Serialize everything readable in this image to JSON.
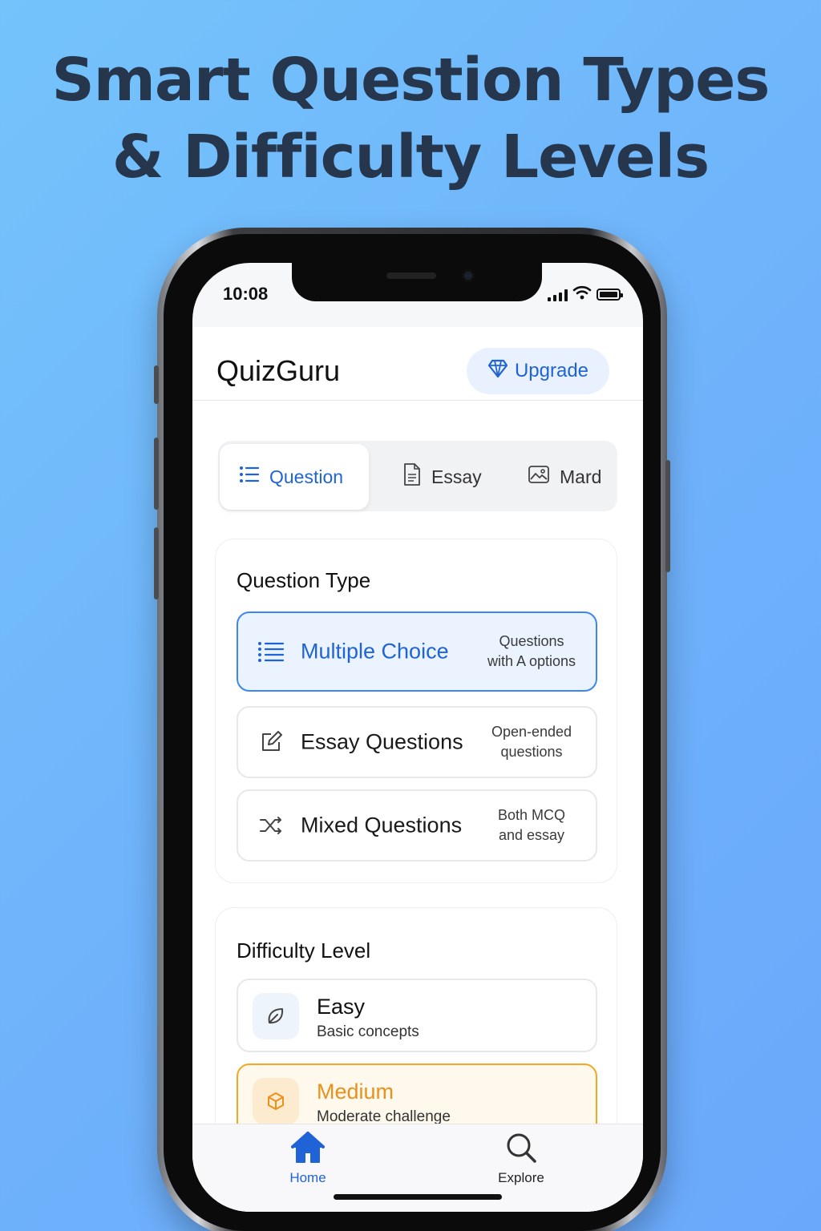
{
  "headline": {
    "line1": "Smart Question Types",
    "line2": "& Difficulty Levels"
  },
  "status_bar": {
    "time": "10:08",
    "icons": [
      "signal-icon",
      "wifi-icon",
      "battery-icon"
    ]
  },
  "header": {
    "title": "QuizGuru",
    "upgrade_label": "Upgrade",
    "upgrade_icon": "diamond-icon"
  },
  "tabs": [
    {
      "label": "Question",
      "icon": "list-icon",
      "active": true
    },
    {
      "label": "Essay",
      "icon": "document-icon",
      "active": false
    },
    {
      "label": "Mard",
      "icon": "image-icon",
      "active": false
    }
  ],
  "question_type": {
    "title": "Question Type",
    "options": [
      {
        "label": "Multiple Choice",
        "desc_line1": "Questions",
        "desc_line2": "with A options",
        "icon": "list-icon",
        "selected": true
      },
      {
        "label": "Essay Questions",
        "desc_line1": "Open-ended",
        "desc_line2": "questions",
        "icon": "edit-icon",
        "selected": false
      },
      {
        "label": "Mixed Questions",
        "desc_line1": "Both MCQ",
        "desc_line2": "and essay",
        "icon": "shuffle-icon",
        "selected": false
      }
    ]
  },
  "difficulty": {
    "title": "Difficulty Level",
    "levels": [
      {
        "name": "Easy",
        "desc": "Basic concepts",
        "icon": "leaf-icon",
        "selected": false
      },
      {
        "name": "Medium",
        "desc": "Moderate challenge",
        "icon": "cube-icon",
        "selected": true
      }
    ]
  },
  "bottom_nav": {
    "items": [
      {
        "label": "Home",
        "icon": "home-icon",
        "active": true
      },
      {
        "label": "Explore",
        "icon": "search-icon",
        "active": false
      }
    ]
  },
  "colors": {
    "accent": "#1f63d6",
    "medium_accent": "#f5a623",
    "headline": "#26364c"
  }
}
